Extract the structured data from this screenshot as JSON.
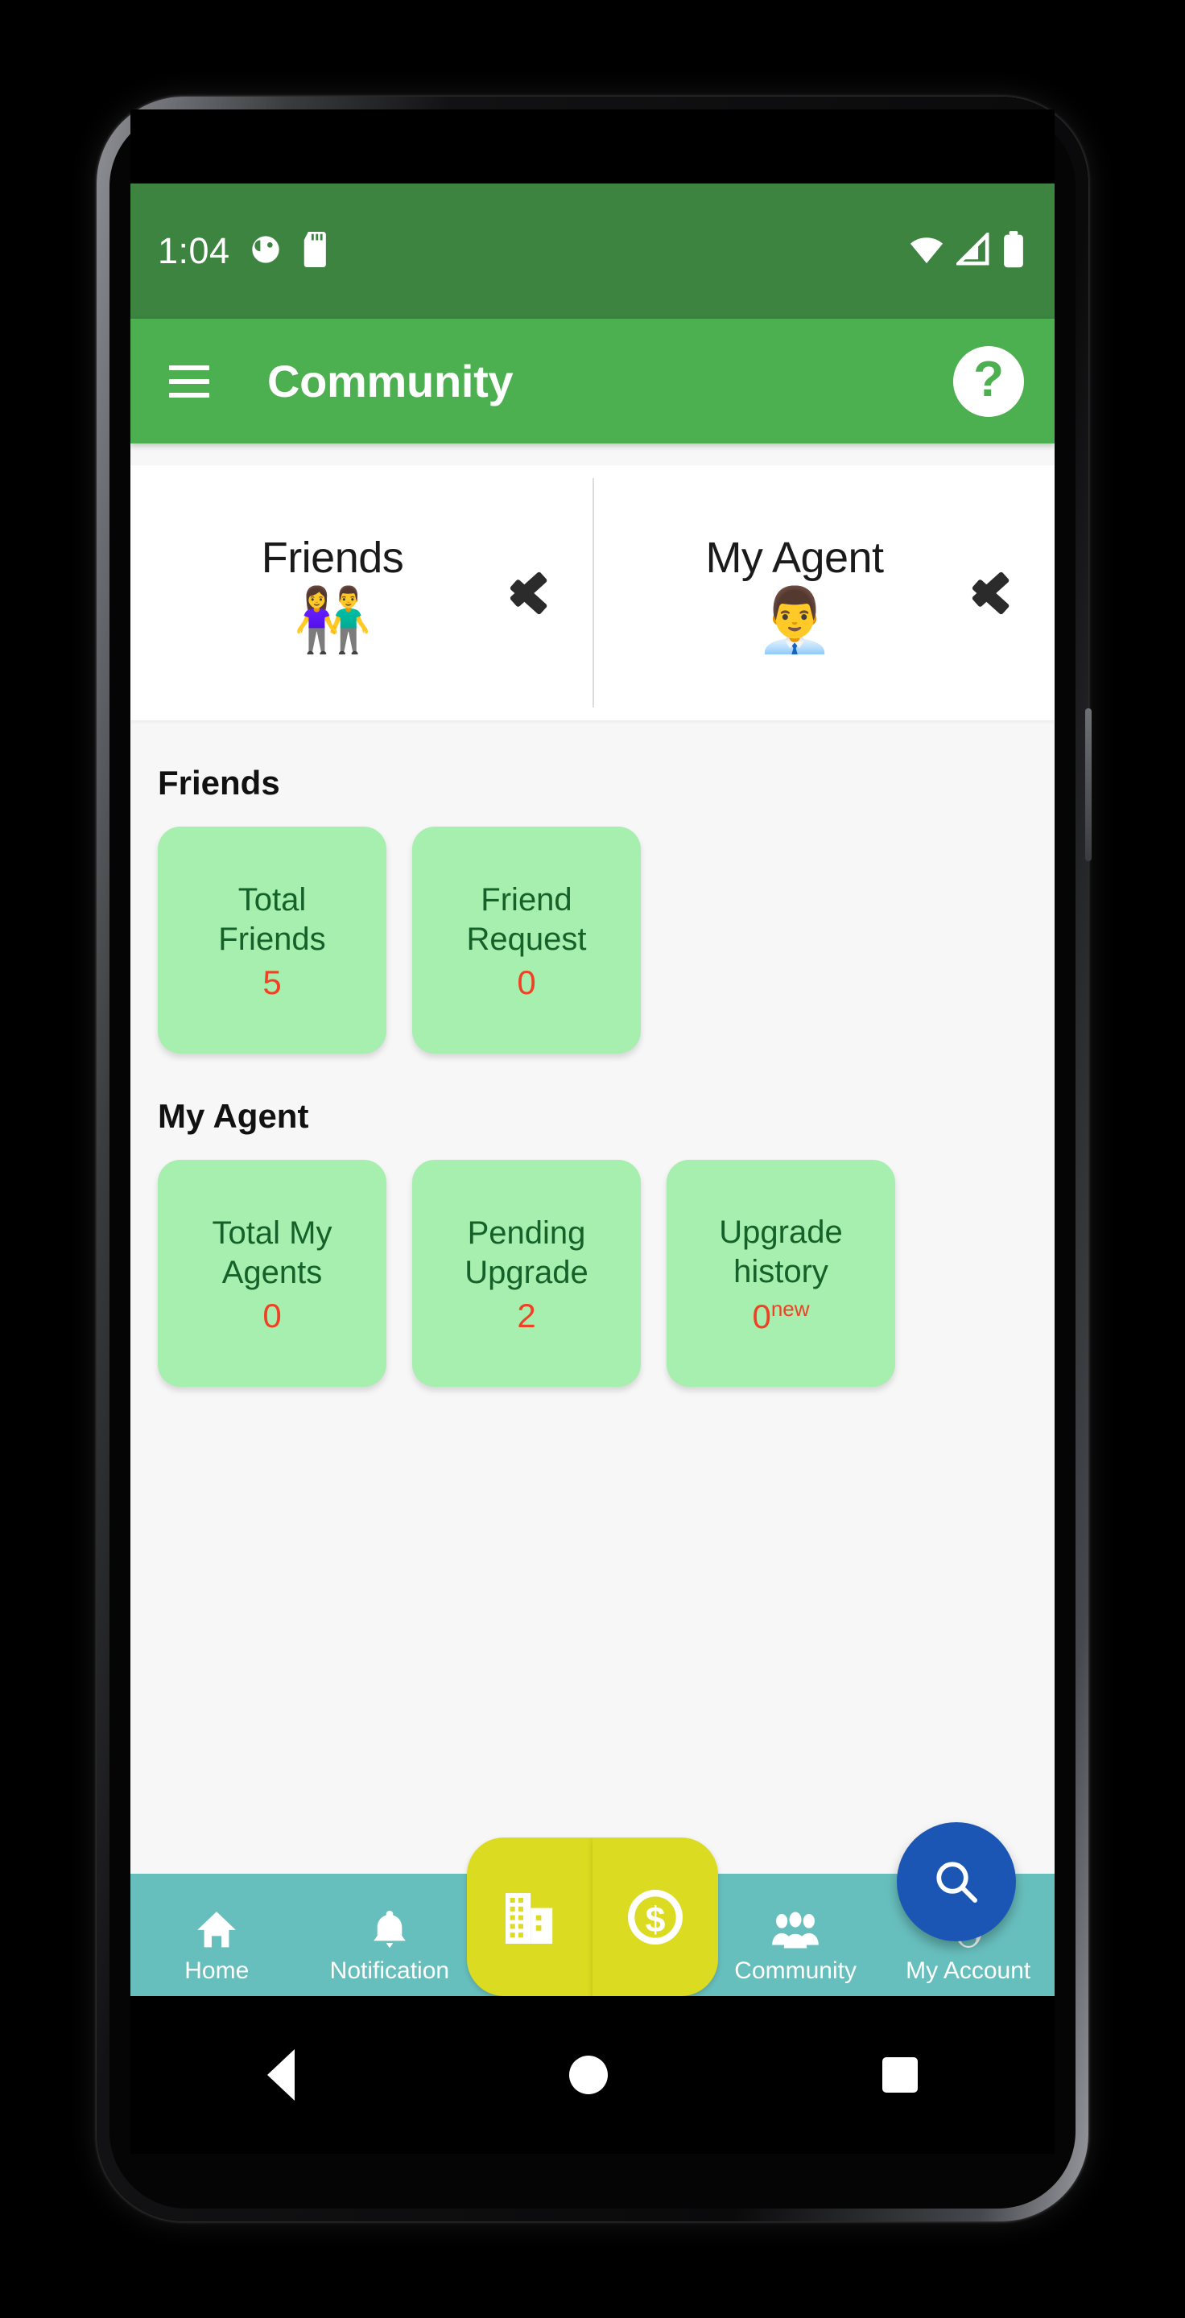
{
  "status_bar": {
    "clock": "1:04",
    "left_icons": [
      "do-not-disturb-icon",
      "sd-card-icon"
    ],
    "right_icons": [
      "wifi-icon",
      "cellular-signal-icon",
      "battery-icon"
    ],
    "background_color": "#3C8440"
  },
  "app_bar": {
    "menu_icon": "hamburger-menu-icon",
    "title": "Community",
    "help_icon": "help-circle-icon",
    "help_glyph": "?",
    "background_color": "#4CAF50"
  },
  "nav_cards": [
    {
      "title": "Friends",
      "emoji": "👫",
      "icon_name": "friends-group-icon",
      "chevron": "chevron-right-icon"
    },
    {
      "title": "My Agent",
      "emoji": "👨‍💼",
      "icon_name": "agent-hierarchy-icon",
      "chevron": "chevron-right-icon"
    }
  ],
  "sections": [
    {
      "id": "friends",
      "title": "Friends",
      "cards": [
        {
          "label": "Total\nFriends",
          "label_line1": "Total",
          "label_line2": "Friends",
          "value": "5",
          "badge": ""
        },
        {
          "label": "Friend\nRequest",
          "label_line1": "Friend",
          "label_line2": "Request",
          "value": "0",
          "badge": ""
        }
      ]
    },
    {
      "id": "my-agent",
      "title": "My Agent",
      "cards": [
        {
          "label_line1": "Total My",
          "label_line2": "Agents",
          "value": "0",
          "badge": ""
        },
        {
          "label_line1": "Pending",
          "label_line2": "Upgrade",
          "value": "2",
          "badge": ""
        },
        {
          "label_line1": "Upgrade",
          "label_line2": "history",
          "value": "0",
          "badge": "new"
        }
      ]
    }
  ],
  "fab": {
    "icon_name": "search-icon",
    "color": "#1B56B5"
  },
  "bottom_nav": {
    "background_color": "#67BFBD",
    "center_color": "#DBDB21",
    "items": [
      {
        "label": "Home",
        "icon_name": "home-icon"
      },
      {
        "label": "Notification",
        "icon_name": "bell-icon"
      },
      {
        "label": "Community",
        "icon_name": "people-group-icon"
      },
      {
        "label": "My Account",
        "icon_name": "account-person-icon"
      }
    ],
    "center_buttons": [
      {
        "icon_name": "building-icon"
      },
      {
        "icon_name": "dollar-coin-icon"
      }
    ]
  },
  "system_nav": {
    "back": "back-triangle-icon",
    "home": "home-circle-icon",
    "recents": "recents-square-icon"
  },
  "theme": {
    "card_green": "#A6EFAE",
    "card_label_green": "#14622A",
    "value_red": "#F04124",
    "content_background": "#F7F7F7"
  }
}
